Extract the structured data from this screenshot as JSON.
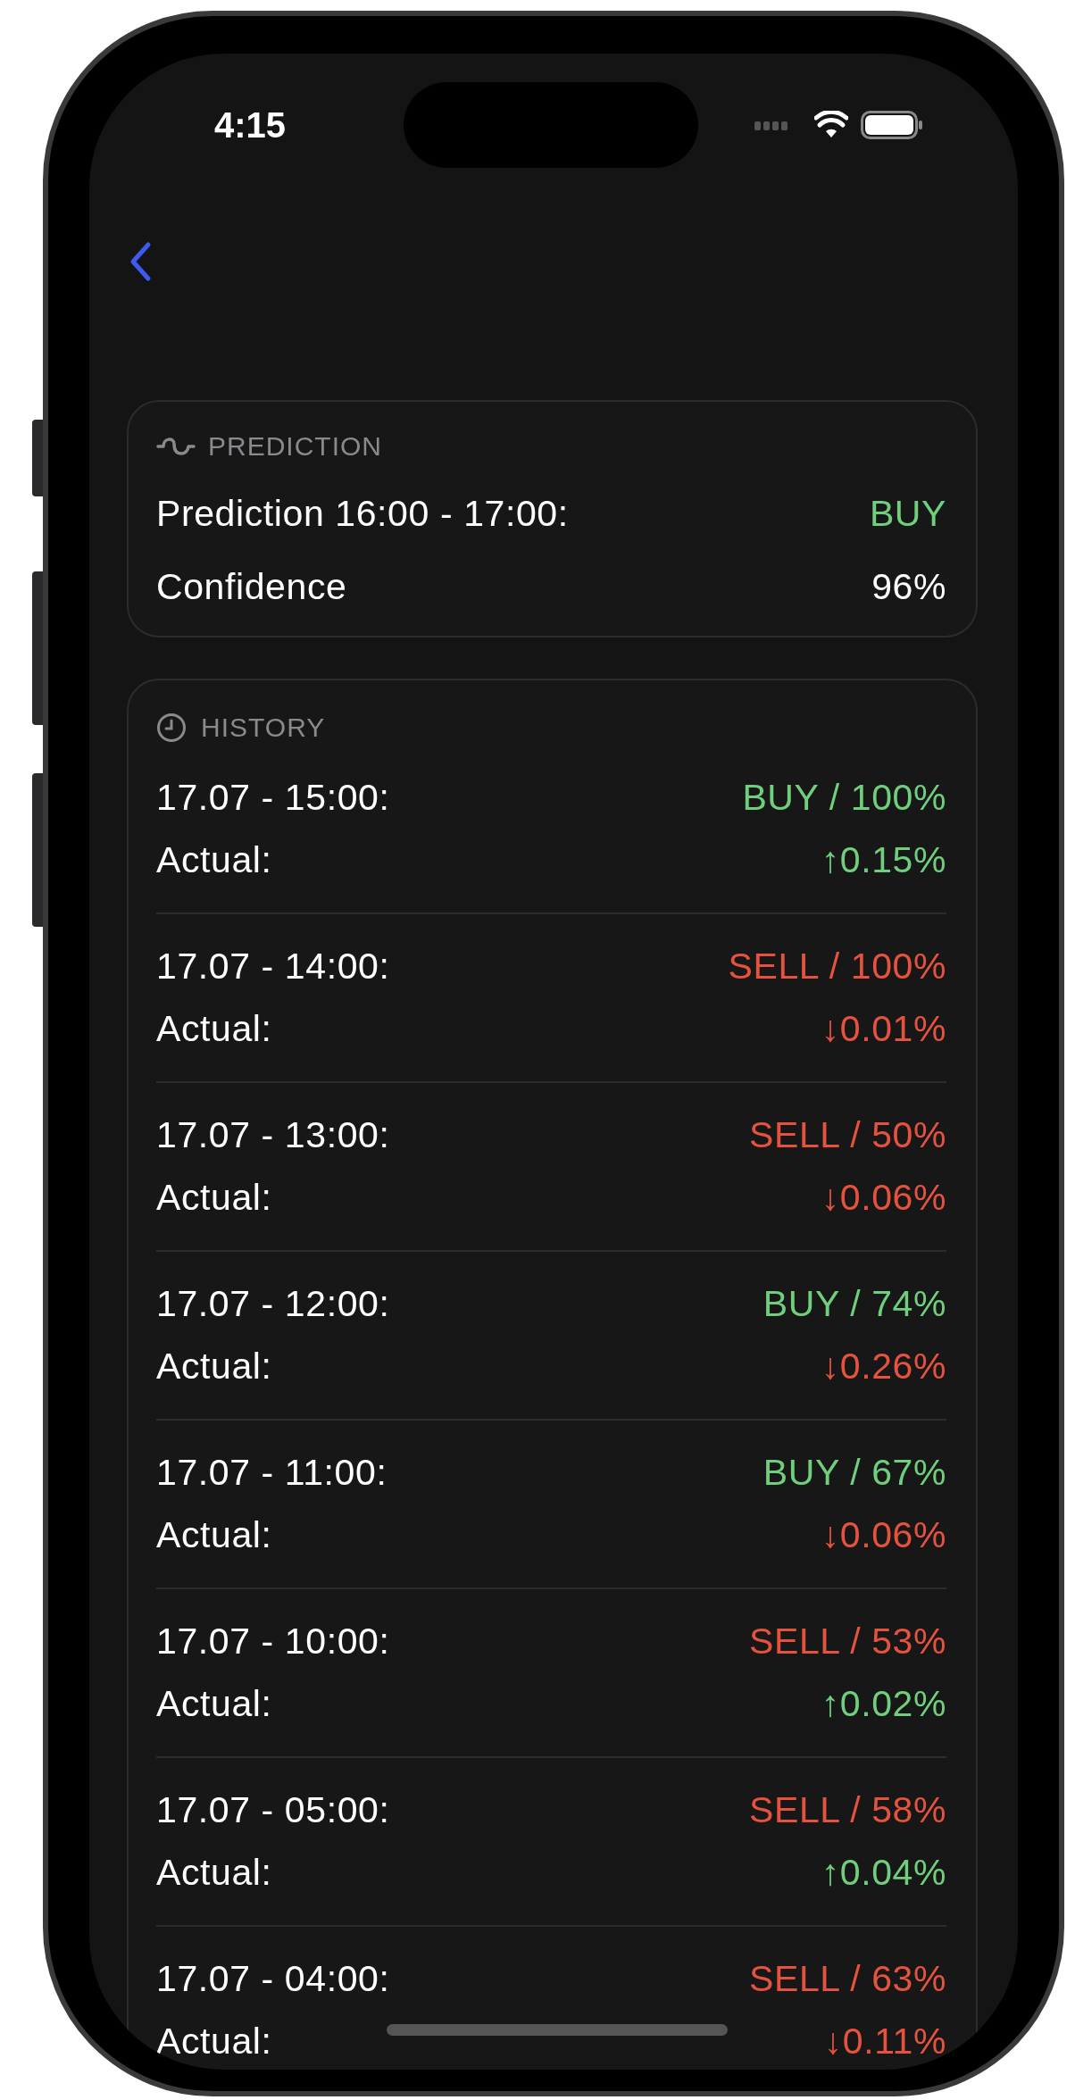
{
  "status_bar": {
    "time": "4:15"
  },
  "prediction": {
    "title": "PREDICTION",
    "rows": [
      {
        "label": "Prediction 16:00 - 17:00:",
        "value": "BUY",
        "color": "#6fcf7d"
      },
      {
        "label": "Confidence",
        "value": "96%",
        "color": "#ffffff"
      }
    ]
  },
  "history": {
    "title": "HISTORY",
    "items": [
      {
        "time": "17.07 - 15:00:",
        "prediction": {
          "text": "BUY / 100%",
          "color": "#6fcf7d"
        },
        "actual_label": "Actual:",
        "actual": {
          "text": "↑0.15%",
          "color": "#6fcf7d"
        }
      },
      {
        "time": "17.07 - 14:00:",
        "prediction": {
          "text": "SELL / 100%",
          "color": "#e5533f"
        },
        "actual_label": "Actual:",
        "actual": {
          "text": "↓0.01%",
          "color": "#e5533f"
        }
      },
      {
        "time": "17.07 - 13:00:",
        "prediction": {
          "text": "SELL / 50%",
          "color": "#e5533f"
        },
        "actual_label": "Actual:",
        "actual": {
          "text": "↓0.06%",
          "color": "#e5533f"
        }
      },
      {
        "time": "17.07 - 12:00:",
        "prediction": {
          "text": "BUY / 74%",
          "color": "#6fcf7d"
        },
        "actual_label": "Actual:",
        "actual": {
          "text": "↓0.26%",
          "color": "#e5533f"
        }
      },
      {
        "time": "17.07 - 11:00:",
        "prediction": {
          "text": "BUY / 67%",
          "color": "#6fcf7d"
        },
        "actual_label": "Actual:",
        "actual": {
          "text": "↓0.06%",
          "color": "#e5533f"
        }
      },
      {
        "time": "17.07 - 10:00:",
        "prediction": {
          "text": "SELL / 53%",
          "color": "#e5533f"
        },
        "actual_label": "Actual:",
        "actual": {
          "text": "↑0.02%",
          "color": "#6fcf7d"
        }
      },
      {
        "time": "17.07 - 05:00:",
        "prediction": {
          "text": "SELL / 58%",
          "color": "#e5533f"
        },
        "actual_label": "Actual:",
        "actual": {
          "text": "↑0.04%",
          "color": "#6fcf7d"
        }
      },
      {
        "time": "17.07 - 04:00:",
        "prediction": {
          "text": "SELL / 63%",
          "color": "#e5533f"
        },
        "actual_label": "Actual:",
        "actual": {
          "text": "↓0.11%",
          "color": "#e5533f"
        }
      }
    ]
  }
}
